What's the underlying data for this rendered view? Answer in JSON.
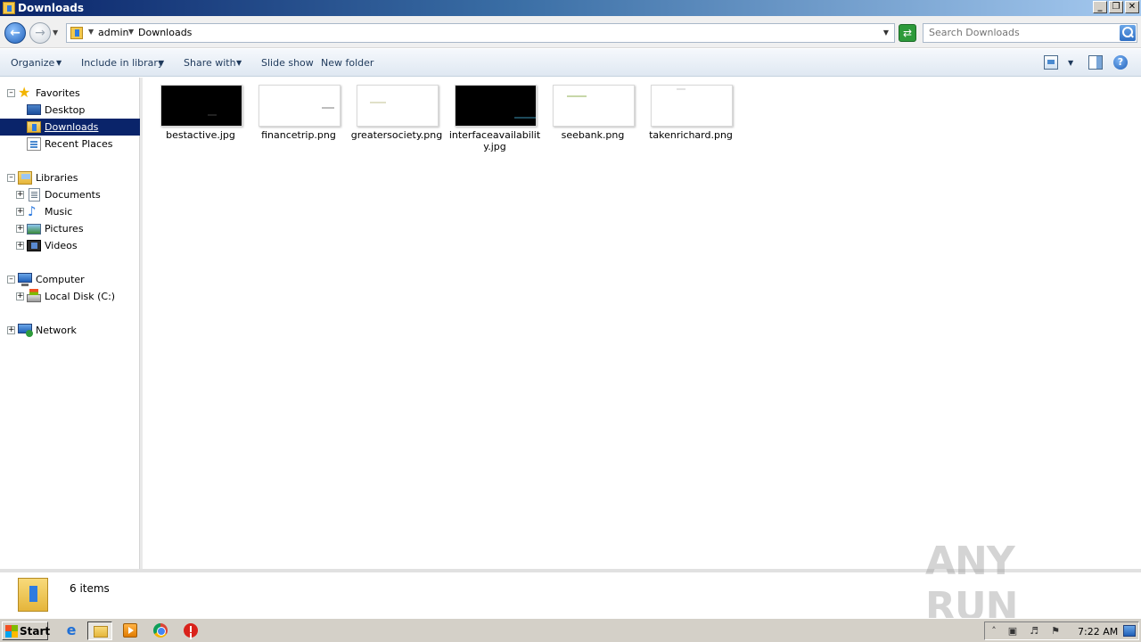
{
  "window": {
    "title": "Downloads",
    "controls": {
      "minimize": "_",
      "restore": "❐",
      "close": "✕"
    }
  },
  "address": {
    "crumbs": [
      "admin",
      "Downloads"
    ],
    "search_placeholder": "Search Downloads"
  },
  "toolbar": {
    "organize": "Organize",
    "include_in_library": "Include in library",
    "share_with": "Share with",
    "slide_show": "Slide show",
    "new_folder": "New folder"
  },
  "nav": {
    "favorites": "Favorites",
    "desktop": "Desktop",
    "downloads": "Downloads",
    "recent_places": "Recent Places",
    "libraries": "Libraries",
    "documents": "Documents",
    "music": "Music",
    "pictures": "Pictures",
    "videos": "Videos",
    "computer": "Computer",
    "local_disk": "Local Disk (C:)",
    "network": "Network"
  },
  "files": [
    {
      "name": "bestactive.jpg",
      "thumb": "dark"
    },
    {
      "name": "financetrip.png",
      "thumb": "light"
    },
    {
      "name": "greatersociety.png",
      "thumb": "light"
    },
    {
      "name": "interfaceavailability.jpg",
      "thumb": "dark"
    },
    {
      "name": "seebank.png",
      "thumb": "light"
    },
    {
      "name": "takenrichard.png",
      "thumb": "light"
    }
  ],
  "status": {
    "count": "6 items"
  },
  "watermark": "ANY RUN",
  "taskbar": {
    "start": "Start",
    "clock": "7:22 AM"
  }
}
